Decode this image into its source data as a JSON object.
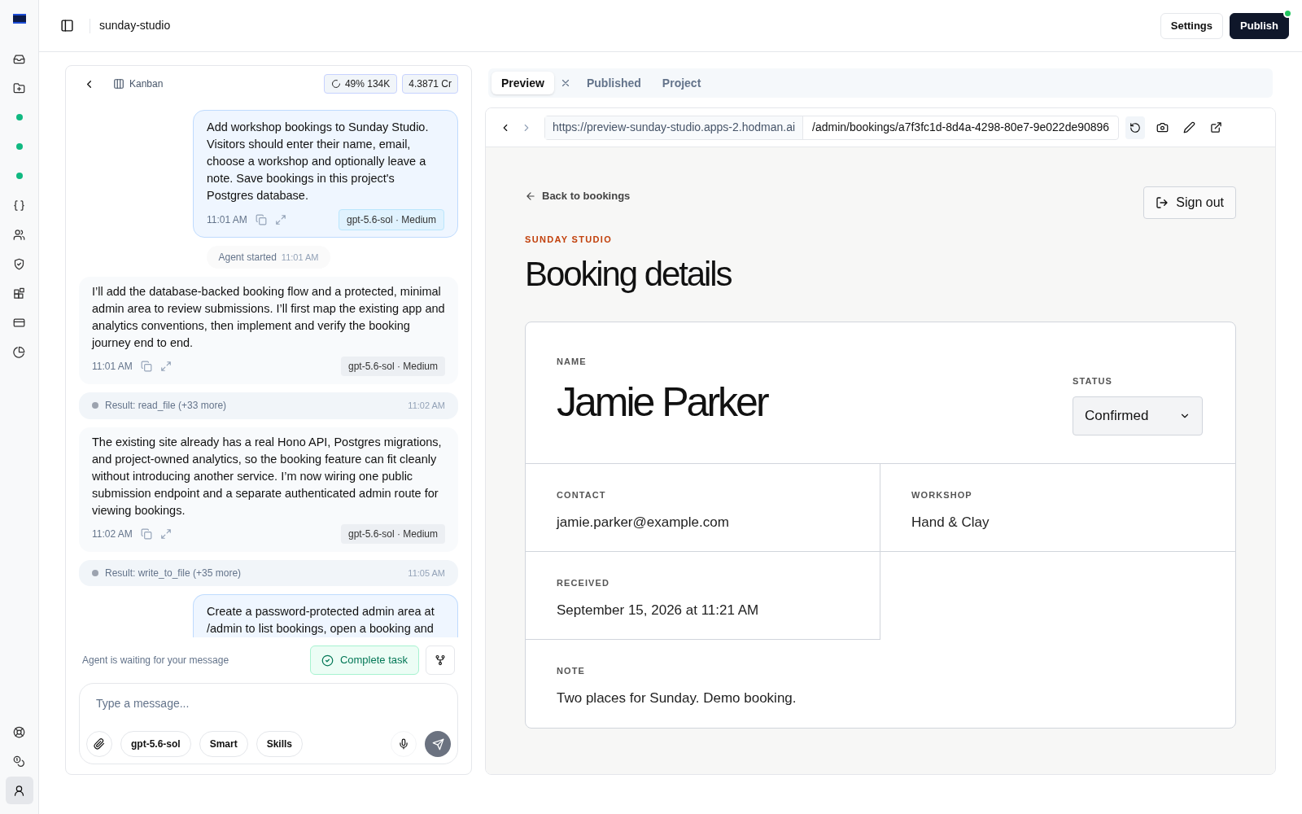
{
  "topbar": {
    "project": "sunday-studio",
    "buttons": [
      {
        "label": "Settings",
        "kind": "secondary",
        "notify": false
      },
      {
        "label": "Publish",
        "kind": "primary",
        "notify": true
      }
    ]
  },
  "rail_items": [
    {
      "selected": false
    },
    {
      "selected": false
    },
    {
      "selected": false
    },
    {
      "selected": false
    },
    {
      "selected": false
    },
    {
      "selected": false
    },
    {
      "selected": false
    },
    {
      "selected": false
    },
    {
      "selected": false
    },
    {
      "selected": false
    },
    {
      "selected": false
    },
    {
      "selected": false
    },
    {
      "selected": false
    },
    {
      "selected": true
    }
  ],
  "chat": {
    "view_label": "Kanban",
    "usage": "49% 134K",
    "credits": "4.3871 Cr",
    "messages": [
      {
        "kind": "user",
        "text": "Add workshop bookings to Sunday Studio. Visitors should enter their name, email, choose a workshop and optionally leave a note. Save bookings in this project's Postgres database.",
        "time": "11:01 AM",
        "model_tag": "gpt-5.6-sol · Medium"
      },
      {
        "kind": "event",
        "text": "Agent started",
        "time": "11:01 AM"
      },
      {
        "kind": "agent",
        "text": "I’ll add the database-backed booking flow and a protected, minimal admin area to review submissions. I’ll first map the existing app and analytics conventions, then implement and verify the booking journey end to end.",
        "time": "11:01 AM",
        "model_tag": "gpt-5.6-sol · Medium"
      },
      {
        "kind": "result",
        "text": "Result: read_file (+33 more)",
        "time": "11:02 AM"
      },
      {
        "kind": "agent",
        "text": "The existing site already has a real Hono API, Postgres migrations, and project-owned analytics, so the booking feature can fit cleanly without introducing another service. I’m now wiring one public submission endpoint and a separate authenticated admin route for viewing bookings.",
        "time": "11:02 AM",
        "model_tag": "gpt-5.6-sol · Medium"
      },
      {
        "kind": "result",
        "text": "Result: write_to_file (+35 more)",
        "time": "11:05 AM"
      },
      {
        "kind": "user",
        "text": "Create a password-protected admin area at /admin to list bookings, open a booking and"
      }
    ],
    "status": "Agent is waiting for your message",
    "complete_button": "Complete task",
    "composer": {
      "placeholder": "Type a message...",
      "chips": [
        "gpt-5.6-sol",
        "Smart",
        "Skills"
      ]
    }
  },
  "preview": {
    "tabs": [
      {
        "label": "Preview",
        "selected": true,
        "closable": true
      },
      {
        "label": "Published",
        "selected": false,
        "closable": false
      },
      {
        "label": "Project",
        "selected": false,
        "closable": false
      }
    ],
    "url_base": "https://preview-sunday-studio.apps-2.hodman.ai",
    "url_path": "/admin/bookings/a7f3fc1d-8d4a-4298-80e7-9e022de90896",
    "page": {
      "back_link": "Back to bookings",
      "sign_out": "Sign out",
      "eyebrow": "SUNDAY STUDIO",
      "heading": "Booking details",
      "name_label": "NAME",
      "name": "Jamie Parker",
      "status_label": "STATUS",
      "status": "Confirmed",
      "fields": [
        {
          "label": "CONTACT",
          "value": "jamie.parker@example.com"
        },
        {
          "label": "WORKSHOP",
          "value": "Hand & Clay"
        },
        {
          "label": "RECEIVED",
          "value": "September 15, 2026 at 11:21 AM"
        }
      ],
      "note_label": "NOTE",
      "note": "Two places for Sunday. Demo booking."
    }
  }
}
